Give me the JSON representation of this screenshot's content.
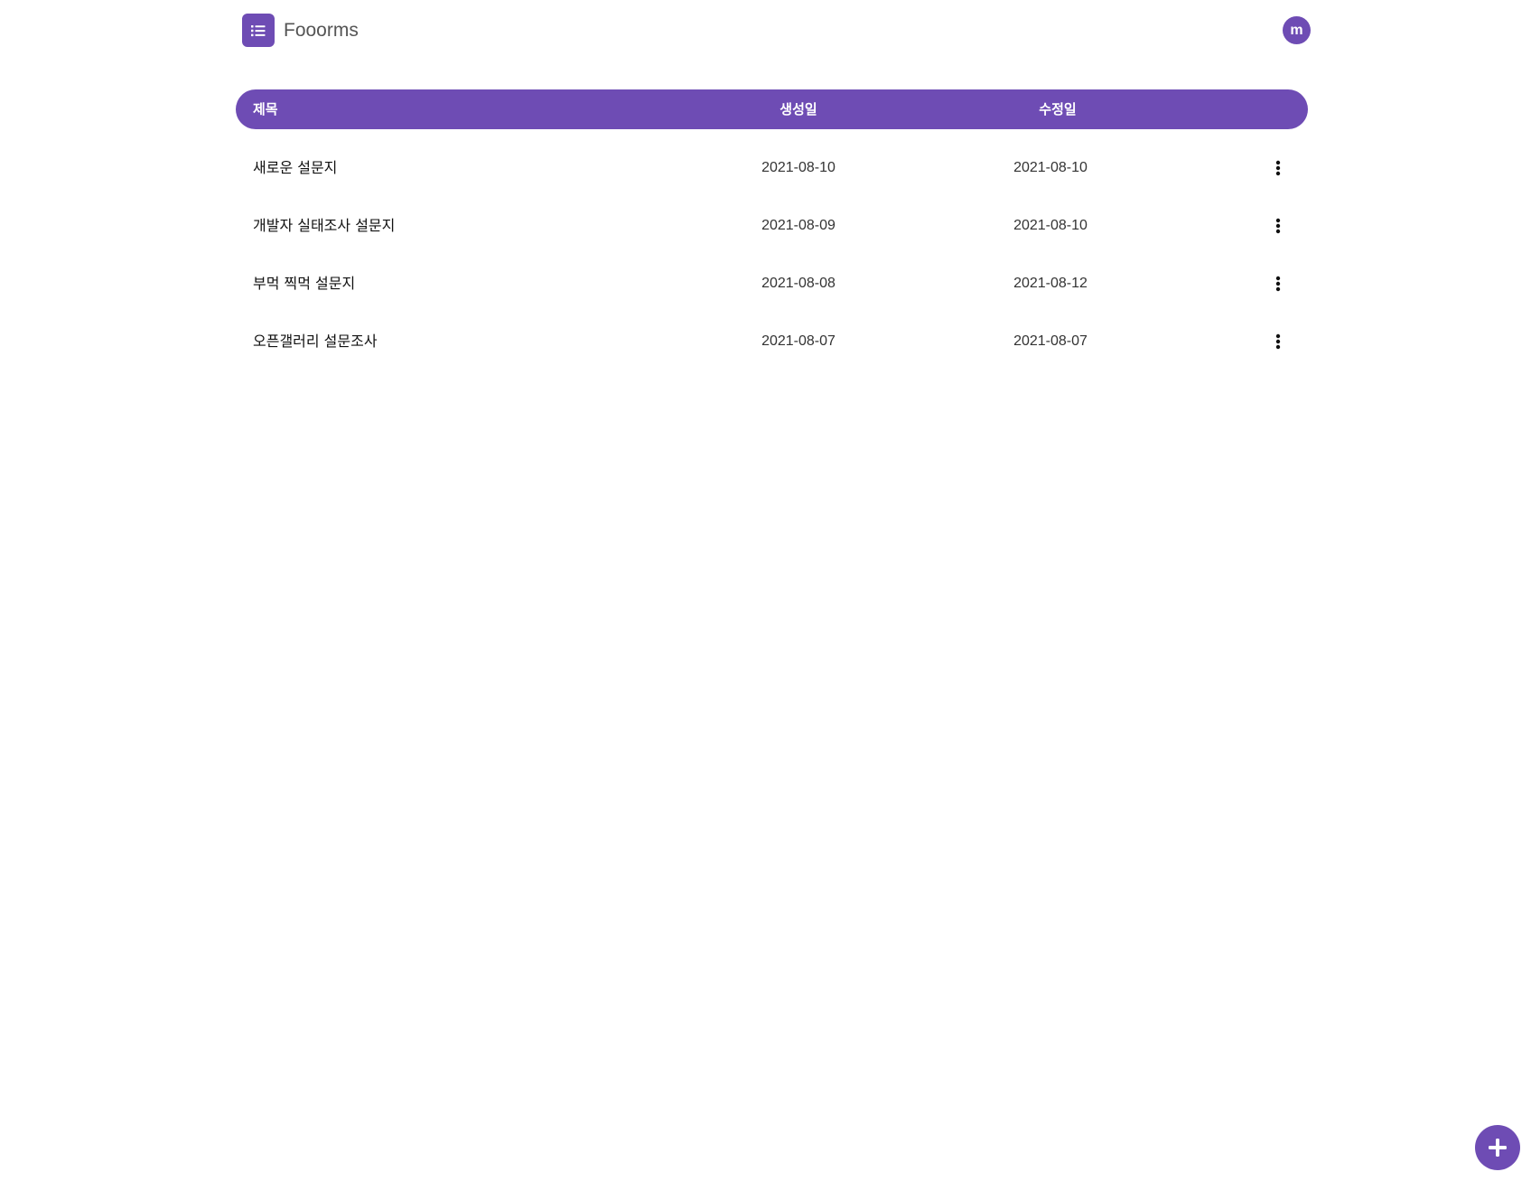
{
  "header": {
    "app_title": "Fooorms",
    "logo_icon": "list-icon",
    "avatar_initial": "m"
  },
  "table": {
    "columns": {
      "title": "제목",
      "created": "생성일",
      "modified": "수정일"
    },
    "rows": [
      {
        "title": "새로운 설문지",
        "created": "2021-08-10",
        "modified": "2021-08-10"
      },
      {
        "title": "개발자 실태조사 설문지",
        "created": "2021-08-09",
        "modified": "2021-08-10"
      },
      {
        "title": "부먹 찍먹 설문지",
        "created": "2021-08-08",
        "modified": "2021-08-12"
      },
      {
        "title": "오픈갤러리 설문조사",
        "created": "2021-08-07",
        "modified": "2021-08-07"
      }
    ]
  },
  "fab": {
    "icon": "plus-icon"
  },
  "colors": {
    "accent": "#6e4cb4",
    "background": "#ffffff",
    "text": "#111111"
  }
}
